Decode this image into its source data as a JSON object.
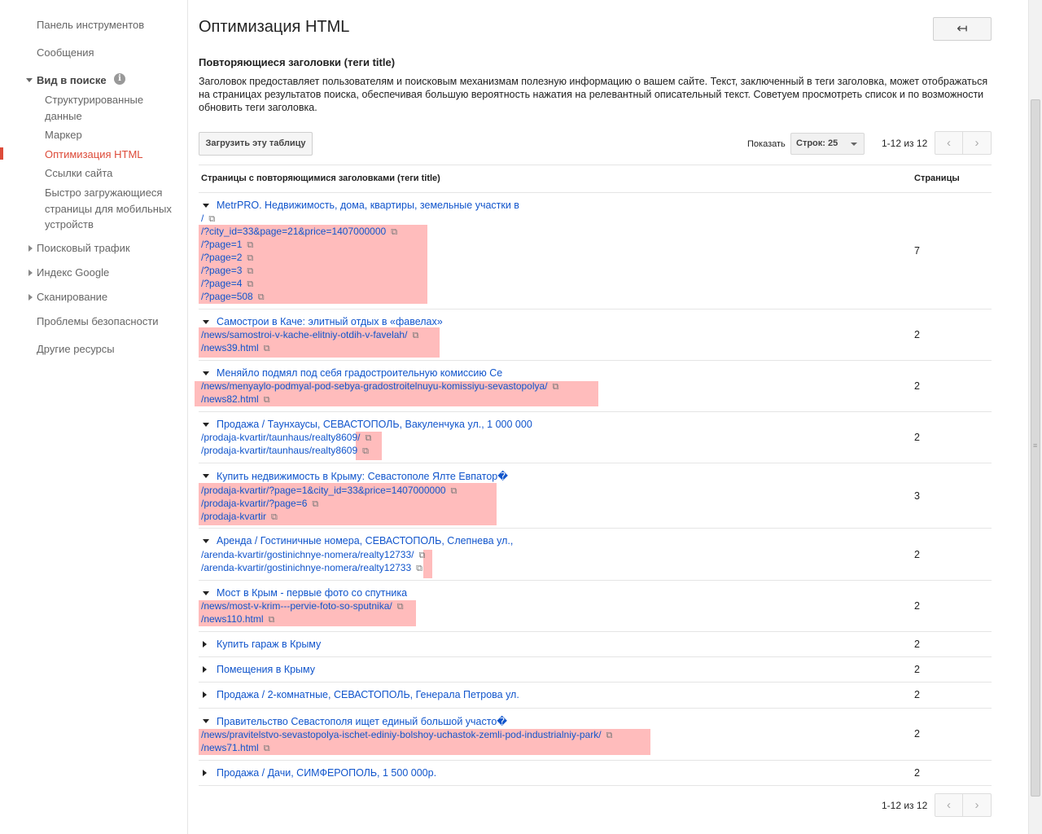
{
  "sidebar": {
    "items": [
      {
        "label": "Панель инструментов"
      },
      {
        "label": "Сообщения"
      },
      {
        "label": "Вид в поиске"
      },
      {
        "label": "Структурированные данные"
      },
      {
        "label": "Маркер"
      },
      {
        "label": "Оптимизация HTML"
      },
      {
        "label": "Ссылки сайта"
      },
      {
        "label": "Быстро загружающиеся страницы для мобильных устройств"
      },
      {
        "label": "Поисковый трафик"
      },
      {
        "label": "Индекс Google"
      },
      {
        "label": "Сканирование"
      },
      {
        "label": "Проблемы безопасности"
      },
      {
        "label": "Другие ресурсы"
      }
    ]
  },
  "header": {
    "title": "Оптимизация HTML",
    "back_icon": "↤"
  },
  "section": {
    "title": "Повторяющиеся заголовки (теги title)",
    "description": "Заголовок предоставляет пользователям и поисковым механизмам полезную информацию о вашем сайте. Текст, заключенный в теги заголовка, может отображаться на страницах результатов поиска, обеспечивая большую вероятность нажатия на релевантный описательный текст. Советуем просмотреть список и по возможности обновить теги заголовка."
  },
  "toolbar": {
    "download_label": "Загрузить эту таблицу",
    "show_label": "Показать",
    "rows_select": "Строк: 25",
    "range_label": "1-12 из 12",
    "prev_icon": "‹",
    "next_icon": "›"
  },
  "table": {
    "headers": {
      "titles": "Страницы с повторяющимися заголовками (теги title)",
      "pages": "Страницы"
    },
    "rows": [
      {
        "title": "MetrPRO. Недвижимость, дома, квартиры, земельные участки в",
        "count": "7",
        "urls": [
          "/",
          "/?city_id=33&page=21&price=1407000000",
          "/?page=1",
          "/?page=2",
          "/?page=3",
          "/?page=4",
          "/?page=508"
        ]
      },
      {
        "title": "Самострои в Каче: элитный отдых в «фавелах»",
        "count": "2",
        "urls": [
          "/news/samostroi-v-kache-elitniy-otdih-v-favelah/",
          "/news39.html"
        ]
      },
      {
        "title": "Меняйло подмял под себя градостроительную комиссию Се",
        "count": "2",
        "urls": [
          "/news/menyaylo-podmyal-pod-sebya-gradostroitelnuyu-komissiyu-sevastopolya/",
          "/news82.html"
        ]
      },
      {
        "title": "Продажа / Таунхаусы, СЕВАСТОПОЛЬ, Вакуленчука ул., 1 000 000",
        "count": "2",
        "urls": [
          "/prodaja-kvartir/taunhaus/realty8609/",
          "/prodaja-kvartir/taunhaus/realty8609"
        ]
      },
      {
        "title": "Купить недвижимость в Крыму: Севастополе Ялте Евпатор�",
        "count": "3",
        "urls": [
          "/prodaja-kvartir/?page=1&city_id=33&price=1407000000",
          "/prodaja-kvartir/?page=6",
          "/prodaja-kvartir"
        ]
      },
      {
        "title": "Аренда / Гостиничные номера, СЕВАСТОПОЛЬ, Слепнева ул.,",
        "count": "2",
        "urls": [
          "/arenda-kvartir/gostinichnye-nomera/realty12733/",
          "/arenda-kvartir/gostinichnye-nomera/realty12733"
        ]
      },
      {
        "title": "Мост в Крым - первые фото со спутника",
        "count": "2",
        "urls": [
          "/news/most-v-krim---pervie-foto-so-sputnika/",
          "/news110.html"
        ]
      },
      {
        "title": "Купить гараж в Крыму",
        "count": "2",
        "urls": []
      },
      {
        "title": "Помещения в Крыму",
        "count": "2",
        "urls": []
      },
      {
        "title": "Продажа / 2-комнатные, СЕВАСТОПОЛЬ, Генерала Петрова ул.",
        "count": "2",
        "urls": []
      },
      {
        "title": "Правительство Севастополя ищет единый большой участо�",
        "count": "2",
        "urls": [
          "/news/pravitelstvo-sevastopolya-ischet-ediniy-bolshoy-uchastok-zemli-pod-industrialniy-park/",
          "/news71.html"
        ]
      },
      {
        "title": "Продажа / Дачи, СИМФЕРОПОЛЬ, 1 500 000р.",
        "count": "2",
        "urls": []
      }
    ]
  },
  "icons": {
    "external_link": "external-link-icon",
    "info": "info-icon"
  },
  "colors": {
    "active": "#dd4b39",
    "link": "#1155cc",
    "highlight": "#ffbcbc"
  }
}
